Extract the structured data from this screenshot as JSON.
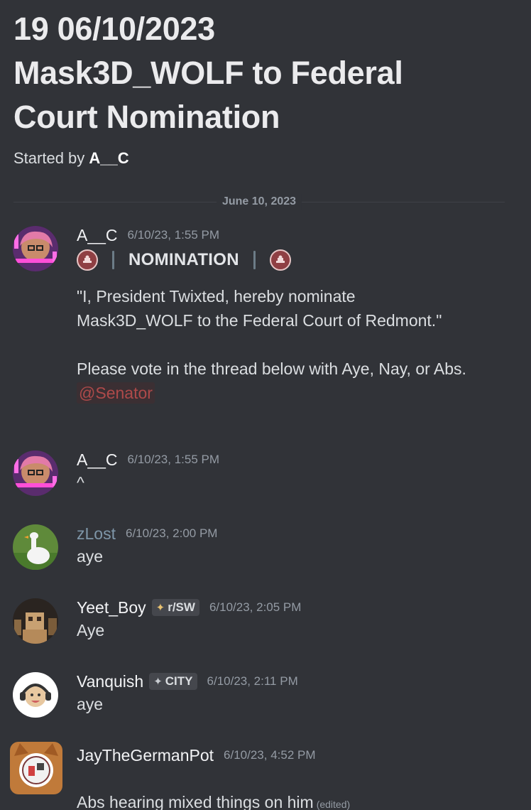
{
  "thread": {
    "title": "19 06/10/2023\nMask3D_WOLF to Federal\nCourt Nomination",
    "started_by_prefix": "Started by",
    "started_by_user": "A__C"
  },
  "date_divider": "June 10, 2023",
  "messages": [
    {
      "user": "A__C",
      "time": "6/10/23, 1:55 PM",
      "header_word": "NOMINATION",
      "text": "\"I, President Twixted, hereby nominate\nMask3D_WOLF to the Federal Court of Redmont.\"\n\nPlease vote in the thread below with Aye, Nay, or Abs.",
      "mention": "@Senator"
    },
    {
      "user": "A__C",
      "time": "6/10/23, 1:55 PM",
      "text": "^"
    },
    {
      "user": "zLost",
      "time": "6/10/23, 2:00 PM",
      "text": "aye"
    },
    {
      "user": "Yeet_Boy",
      "tag": "r/SW",
      "time": "6/10/23, 2:05 PM",
      "text": "Aye"
    },
    {
      "user": "Vanquish",
      "tag": "CITY",
      "time": "6/10/23, 2:11 PM",
      "text": "aye"
    },
    {
      "user": "JayTheGermanPot",
      "time": "6/10/23, 4:52 PM",
      "text": "Abs hearing mixed things on him",
      "edited": "(edited)"
    }
  ],
  "icons": {
    "seal": "red-capitol-seal-icon",
    "tag": "diamond-compass-icon"
  },
  "colors": {
    "background": "#313338",
    "mention_text": "#ae4a4a",
    "mention_bg": "#3b2f33",
    "username_zlost": "#7e96a8",
    "seal": "#8f3f43"
  }
}
